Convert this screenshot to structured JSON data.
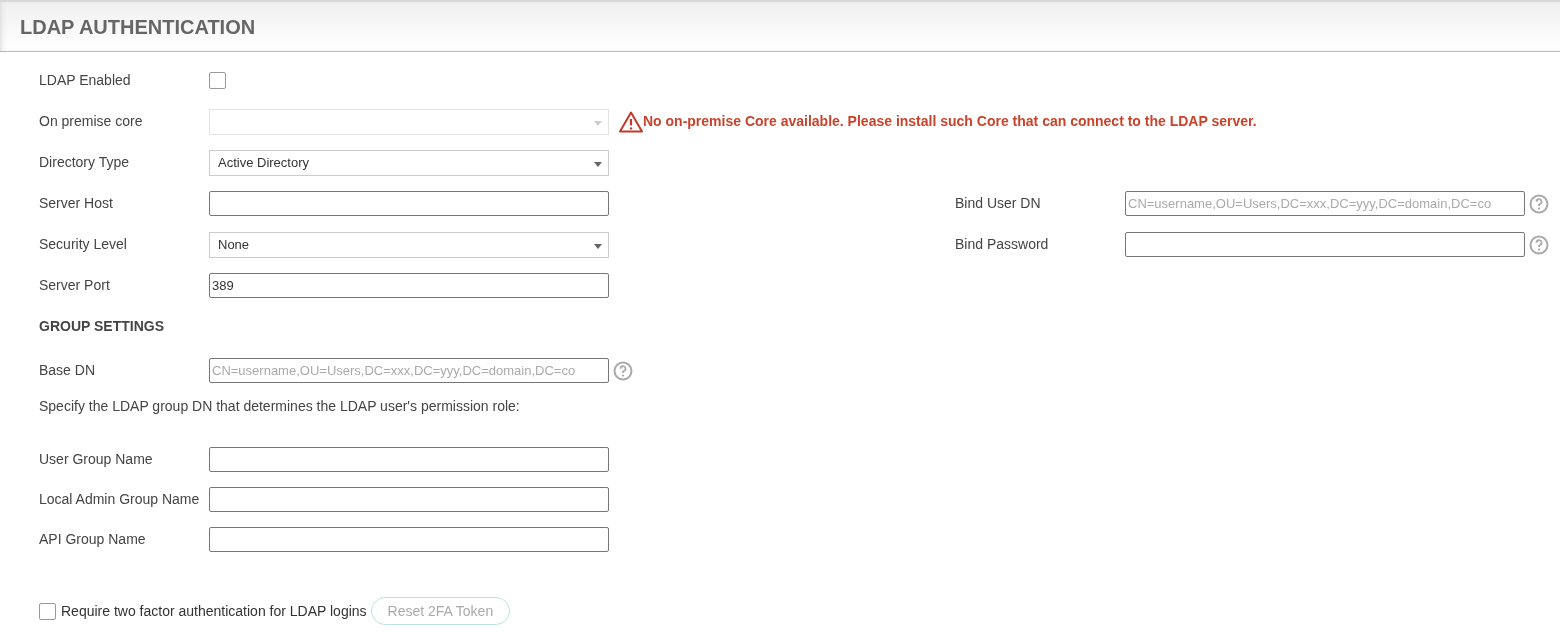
{
  "header": {
    "title": "LDAP AUTHENTICATION"
  },
  "fields": [
    {
      "kind": "checkbox",
      "label": "LDAP Enabled",
      "checked": false
    },
    {
      "kind": "select",
      "label": "On premise core",
      "disabled": true,
      "error": "No on-premise Core available. Please install such Core that can connect to the LDAP server."
    },
    {
      "kind": "select",
      "label": "Directory Type",
      "value": "Active Directory",
      "disabled": false
    },
    {
      "kind": "text",
      "label": "Server Host"
    },
    {
      "kind": "select",
      "label": "Security Level",
      "value": "None",
      "disabled": false
    },
    {
      "kind": "text",
      "label": "Server Port",
      "value": "389"
    }
  ],
  "bind_fields": [
    {
      "label": "Bind User DN",
      "placeholder": "CN=username,OU=Users,DC=xxx,DC=yyy,DC=domain,DC=co",
      "help": true
    },
    {
      "label": "Bind Password",
      "help": true
    }
  ],
  "group_settings": {
    "title": "GROUP SETTINGS",
    "base_dn": {
      "label": "Base DN",
      "placeholder": "CN=username,OU=Users,DC=xxx,DC=yyy,DC=domain,DC=co",
      "help": true
    },
    "instruction": "Specify the LDAP group DN that determines the LDAP user's permission role:",
    "fields": [
      {
        "label": "User Group Name"
      },
      {
        "label": "Local Admin Group Name"
      },
      {
        "label": "API Group Name"
      }
    ]
  },
  "two_factor": {
    "label": "Require two factor authentication for LDAP logins",
    "checked": false,
    "button": "Reset 2FA Token",
    "button_disabled": true
  }
}
